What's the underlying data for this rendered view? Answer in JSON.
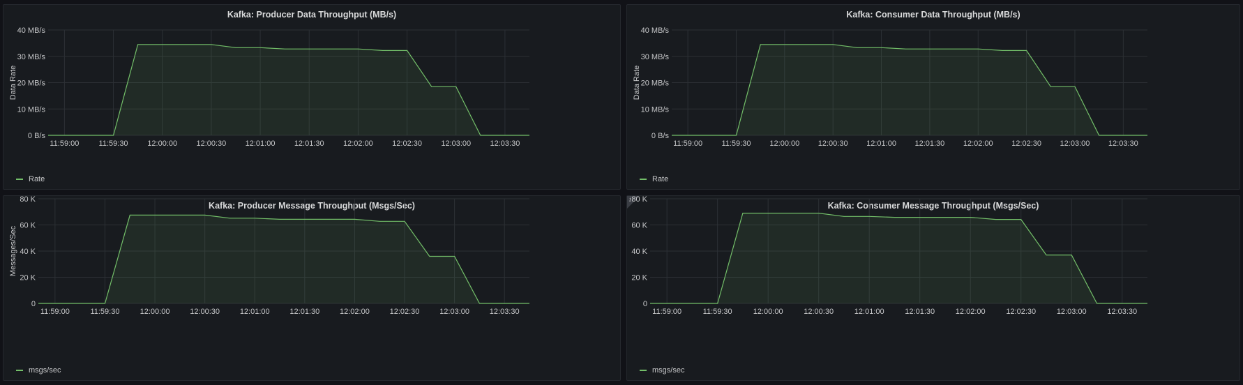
{
  "colors": {
    "series": "#73bf69",
    "grid": "#2c3035",
    "fill": "rgba(115,191,105,0.10)"
  },
  "panels": [
    {
      "title": "Kafka: Producer Data Throughput (MB/s)",
      "legend": "Rate",
      "info": false
    },
    {
      "title": "Kafka: Consumer Data Throughput (MB/s)",
      "legend": "Rate",
      "info": false
    },
    {
      "title": "Kafka: Producer Message Throughput (Msgs/Sec)",
      "legend": "msgs/sec",
      "info": false
    },
    {
      "title": "Kafka: Consumer Message Throughput (Msgs/Sec)",
      "legend": "msgs/sec",
      "info": true,
      "info_icon": "info-icon"
    }
  ],
  "chart_data": [
    {
      "type": "area",
      "title": "Kafka: Producer Data Throughput (MB/s)",
      "ylabel": "Data Rate",
      "xlabel": "",
      "x_ticks": [
        "11:59:00",
        "11:59:30",
        "12:00:00",
        "12:00:30",
        "12:01:00",
        "12:01:30",
        "12:02:00",
        "12:02:30",
        "12:03:00",
        "12:03:30"
      ],
      "y_ticks": [
        "0 B/s",
        "10 MB/s",
        "20 MB/s",
        "30 MB/s",
        "40 MB/s"
      ],
      "ylim": [
        0,
        40
      ],
      "xlim": [
        "11:58:50",
        "12:03:45"
      ],
      "grid": true,
      "legend_position": "bottom-left",
      "series": [
        {
          "name": "Rate",
          "x": [
            "11:58:50",
            "11:59:30",
            "11:59:45",
            "12:00:00",
            "12:00:15",
            "12:00:30",
            "12:00:45",
            "12:01:00",
            "12:01:15",
            "12:01:30",
            "12:01:45",
            "12:02:00",
            "12:02:15",
            "12:02:30",
            "12:02:45",
            "12:03:00",
            "12:03:15",
            "12:03:30",
            "12:03:45"
          ],
          "y": [
            0,
            0,
            34.5,
            34.5,
            34.5,
            34.5,
            33.3,
            33.3,
            32.8,
            32.8,
            32.8,
            32.8,
            32.2,
            32.2,
            18.5,
            18.5,
            0,
            0,
            0
          ]
        }
      ]
    },
    {
      "type": "area",
      "title": "Kafka: Consumer Data Throughput (MB/s)",
      "ylabel": "Data Rate",
      "xlabel": "",
      "x_ticks": [
        "11:59:00",
        "11:59:30",
        "12:00:00",
        "12:00:30",
        "12:01:00",
        "12:01:30",
        "12:02:00",
        "12:02:30",
        "12:03:00",
        "12:03:30"
      ],
      "y_ticks": [
        "0 B/s",
        "10 MB/s",
        "20 MB/s",
        "30 MB/s",
        "40 MB/s"
      ],
      "ylim": [
        0,
        40
      ],
      "xlim": [
        "11:58:50",
        "12:03:45"
      ],
      "grid": true,
      "legend_position": "bottom-left",
      "series": [
        {
          "name": "Rate",
          "x": [
            "11:58:50",
            "11:59:30",
            "11:59:45",
            "12:00:00",
            "12:00:15",
            "12:00:30",
            "12:00:45",
            "12:01:00",
            "12:01:15",
            "12:01:30",
            "12:01:45",
            "12:02:00",
            "12:02:15",
            "12:02:30",
            "12:02:45",
            "12:03:00",
            "12:03:15",
            "12:03:30",
            "12:03:45"
          ],
          "y": [
            0,
            0,
            34.5,
            34.5,
            34.5,
            34.5,
            33.3,
            33.3,
            32.8,
            32.8,
            32.8,
            32.8,
            32.2,
            32.2,
            18.5,
            18.5,
            0,
            0,
            0
          ]
        }
      ]
    },
    {
      "type": "area",
      "title": "Kafka: Producer Message Throughput (Msgs/Sec)",
      "ylabel": "Messages/Sec",
      "xlabel": "",
      "x_ticks": [
        "11:59:00",
        "11:59:30",
        "12:00:00",
        "12:00:30",
        "12:01:00",
        "12:01:30",
        "12:02:00",
        "12:02:30",
        "12:03:00",
        "12:03:30"
      ],
      "y_ticks": [
        "0",
        "20 K",
        "40 K",
        "60 K",
        "80 K"
      ],
      "ylim": [
        0,
        80000
      ],
      "xlim": [
        "11:58:50",
        "12:03:45"
      ],
      "grid": true,
      "legend_position": "bottom-left",
      "series": [
        {
          "name": "msgs/sec",
          "x": [
            "11:58:50",
            "11:59:30",
            "11:59:45",
            "12:00:00",
            "12:00:15",
            "12:00:30",
            "12:00:45",
            "12:01:00",
            "12:01:15",
            "12:01:30",
            "12:01:45",
            "12:02:00",
            "12:02:15",
            "12:02:30",
            "12:02:45",
            "12:03:00",
            "12:03:15",
            "12:03:30",
            "12:03:45"
          ],
          "y": [
            0,
            0,
            67500,
            67500,
            67500,
            67500,
            65200,
            65200,
            64300,
            64300,
            64300,
            64300,
            62800,
            62800,
            36000,
            36000,
            0,
            0,
            0
          ]
        }
      ]
    },
    {
      "type": "area",
      "title": "Kafka: Consumer Message Throughput (Msgs/Sec)",
      "ylabel": "",
      "xlabel": "",
      "x_ticks": [
        "11:59:00",
        "11:59:30",
        "12:00:00",
        "12:00:30",
        "12:01:00",
        "12:01:30",
        "12:02:00",
        "12:02:30",
        "12:03:00",
        "12:03:30"
      ],
      "y_ticks": [
        "0",
        "20 K",
        "40 K",
        "60 K",
        "80 K"
      ],
      "ylim": [
        0,
        80000
      ],
      "xlim": [
        "11:58:50",
        "12:03:45"
      ],
      "grid": true,
      "legend_position": "bottom-left",
      "series": [
        {
          "name": "msgs/sec",
          "x": [
            "11:58:50",
            "11:59:30",
            "11:59:45",
            "12:00:00",
            "12:00:15",
            "12:00:30",
            "12:00:45",
            "12:01:00",
            "12:01:15",
            "12:01:30",
            "12:01:45",
            "12:02:00",
            "12:02:15",
            "12:02:30",
            "12:02:45",
            "12:03:00",
            "12:03:15",
            "12:03:30",
            "12:03:45"
          ],
          "y": [
            0,
            0,
            69000,
            69000,
            69000,
            69000,
            66500,
            66500,
            65800,
            65800,
            65800,
            65800,
            64200,
            64200,
            37000,
            37000,
            0,
            0,
            0
          ]
        }
      ]
    }
  ]
}
